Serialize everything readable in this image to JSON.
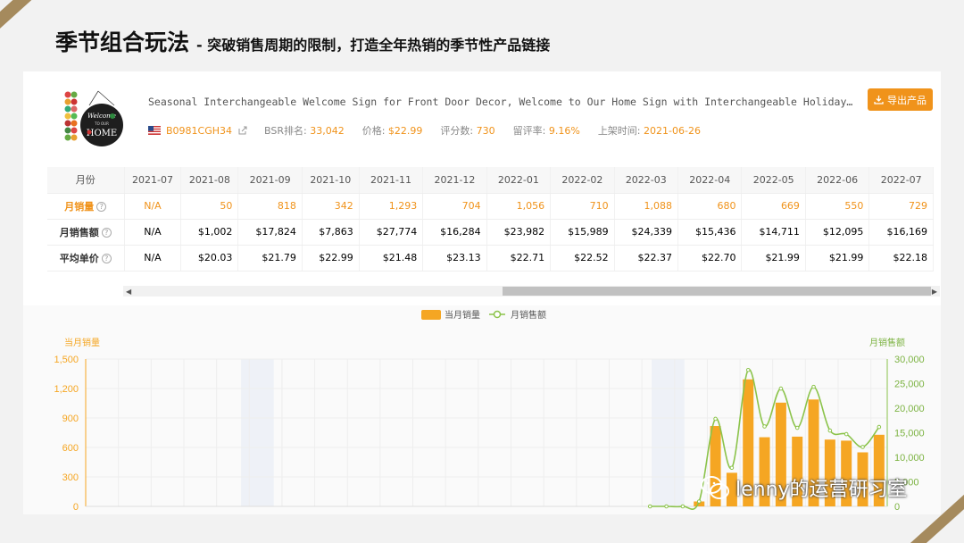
{
  "slide": {
    "title_main": "季节组合玩法",
    "title_sub": "- 突破销售周期的限制，打造全年热销的季节性产品链接"
  },
  "product": {
    "title": "Seasonal Interchangeable Welcome Sign for Front Door Decor, Welcome to Our Home Sign with Interchangeable Holiday Pieces, Welcome Door Sign for Front Door",
    "export_label": "导出产品",
    "asin": "B0981CGH34",
    "bsr_label": "BSR排名:",
    "bsr_value": "33,042",
    "price_label": "价格:",
    "price_value": "$22.99",
    "reviews_label": "评分数:",
    "reviews_value": "730",
    "review_rate_label": "留评率:",
    "review_rate_value": "9.16%",
    "listed_label": "上架时间:",
    "listed_value": "2021-06-26",
    "thumb_sign_lines": [
      "Welcome",
      "TO OUR",
      "HOME"
    ]
  },
  "table": {
    "header_label": "月份",
    "months": [
      "2021-07",
      "2021-08",
      "2021-09",
      "2021-10",
      "2021-11",
      "2021-12",
      "2022-01",
      "2022-02",
      "2022-03",
      "2022-04",
      "2022-05",
      "2022-06",
      "2022-07"
    ],
    "rows": [
      {
        "label": "月销量",
        "values": [
          "N/A",
          "50",
          "818",
          "342",
          "1,293",
          "704",
          "1,056",
          "710",
          "1,088",
          "680",
          "669",
          "550",
          "729"
        ]
      },
      {
        "label": "月销售额",
        "values": [
          "N/A",
          "$1,002",
          "$17,824",
          "$7,863",
          "$27,774",
          "$16,284",
          "$23,982",
          "$15,989",
          "$24,339",
          "$15,436",
          "$14,711",
          "$12,095",
          "$16,169"
        ]
      },
      {
        "label": "平均单价",
        "values": [
          "N/A",
          "$20.03",
          "$21.79",
          "$22.99",
          "$21.48",
          "$23.13",
          "$22.71",
          "$22.52",
          "$22.37",
          "$22.70",
          "$21.99",
          "$21.99",
          "$22.18"
        ]
      }
    ],
    "help_glyph": "?"
  },
  "chart_data": {
    "type": "bar",
    "legend": [
      "当月销量",
      "月销售额"
    ],
    "ylabel_left": "当月销量",
    "ylabel_right": "月销售额",
    "yticks_left": [
      "0",
      "300",
      "600",
      "900",
      "1,200",
      "1,500"
    ],
    "yticks_right": [
      "0",
      "5,000",
      "10,000",
      "15,000",
      "20,000",
      "25,000",
      "30,000"
    ],
    "ylim_left": [
      0,
      1500
    ],
    "ylim_right": [
      0,
      30000
    ],
    "series": [
      {
        "name": "当月销量",
        "kind": "bar",
        "color": "#f5a623",
        "values": [
          0,
          0,
          0,
          0,
          0,
          0,
          0,
          0,
          0,
          0,
          0,
          0,
          0,
          0,
          0,
          0,
          0,
          0,
          0,
          0,
          0,
          0,
          0,
          0,
          0,
          0,
          0,
          0,
          0,
          0,
          0,
          0,
          0,
          0,
          0,
          0,
          0,
          50,
          818,
          342,
          1293,
          704,
          1056,
          710,
          1088,
          680,
          669,
          550,
          729
        ]
      },
      {
        "name": "月销售额",
        "kind": "line",
        "color": "#8bc34a",
        "values": [
          null,
          null,
          null,
          null,
          null,
          null,
          null,
          null,
          null,
          null,
          null,
          null,
          null,
          null,
          null,
          null,
          null,
          null,
          null,
          null,
          null,
          null,
          null,
          null,
          null,
          null,
          null,
          null,
          null,
          null,
          null,
          null,
          null,
          null,
          0,
          0,
          0,
          1002,
          17824,
          7863,
          27774,
          16284,
          23982,
          15989,
          24339,
          15436,
          14711,
          12095,
          16169
        ]
      }
    ],
    "n_slots": 49
  },
  "watermark": "lenny的运营研习室",
  "colors": {
    "accent": "#f0931b",
    "bar": "#f5a623",
    "line": "#8bc34a",
    "corner": "#a58a5d"
  }
}
